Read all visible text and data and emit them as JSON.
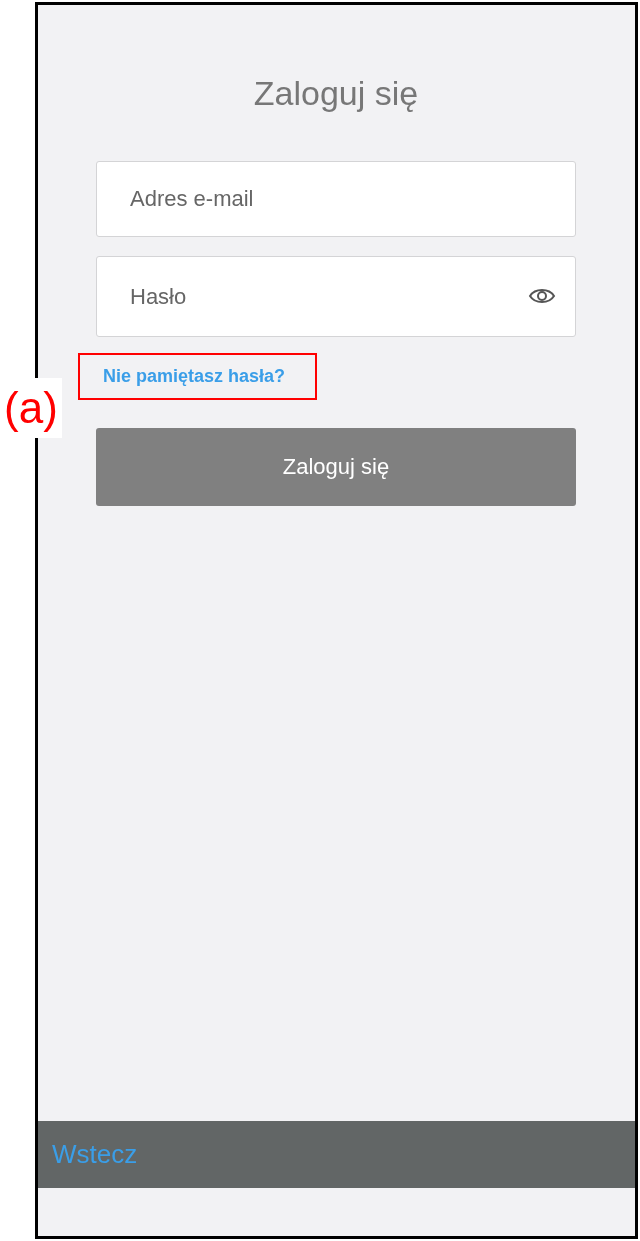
{
  "title": "Zaloguj się",
  "email_field": {
    "placeholder": "Adres e-mail"
  },
  "password_field": {
    "placeholder": "Hasło"
  },
  "forgot_link": "Nie pamiętasz hasła?",
  "login_button": "Zaloguj się",
  "bottom_bar": {
    "back_button": "Wstecz"
  },
  "annotation": {
    "label": "(a)"
  }
}
